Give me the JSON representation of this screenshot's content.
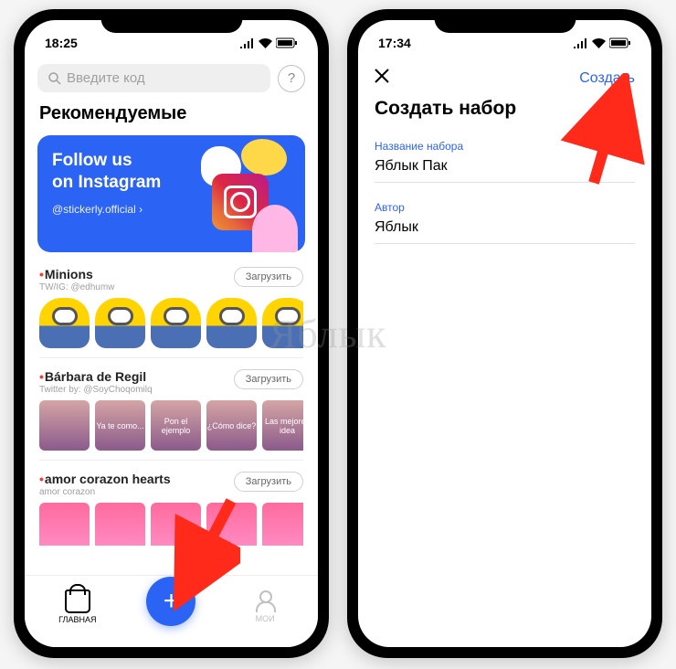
{
  "left": {
    "status_time": "18:25",
    "search_placeholder": "Введите код",
    "section_title": "Рекомендуемые",
    "banner": {
      "line1": "Follow us",
      "line2": "on Instagram",
      "handle": "@stickerly.official ›"
    },
    "packs": [
      {
        "title": "Minions",
        "subtitle": "TW/IG: @edhumw",
        "button": "Загрузить"
      },
      {
        "title": "Bárbara de Regil",
        "subtitle": "Twitter by: @SoyChoqomilq",
        "button": "Загрузить"
      },
      {
        "title": "amor corazon hearts",
        "subtitle": "amor corazon",
        "button": "Загрузить"
      }
    ],
    "barbara_captions": [
      "",
      "Ya te como...",
      "Pon el ejemplo",
      "¿Cómo dice?",
      "Las mejores idea"
    ],
    "nav": {
      "home": "ГЛАВНАЯ",
      "my": "МОИ"
    }
  },
  "right": {
    "status_time": "17:34",
    "create_label": "Создать",
    "modal_title": "Создать набор",
    "field1_label": "Название набора",
    "field1_value": "Яблык Пак",
    "field2_label": "Автор",
    "field2_value": "Яблык"
  },
  "watermark": "Яблык"
}
